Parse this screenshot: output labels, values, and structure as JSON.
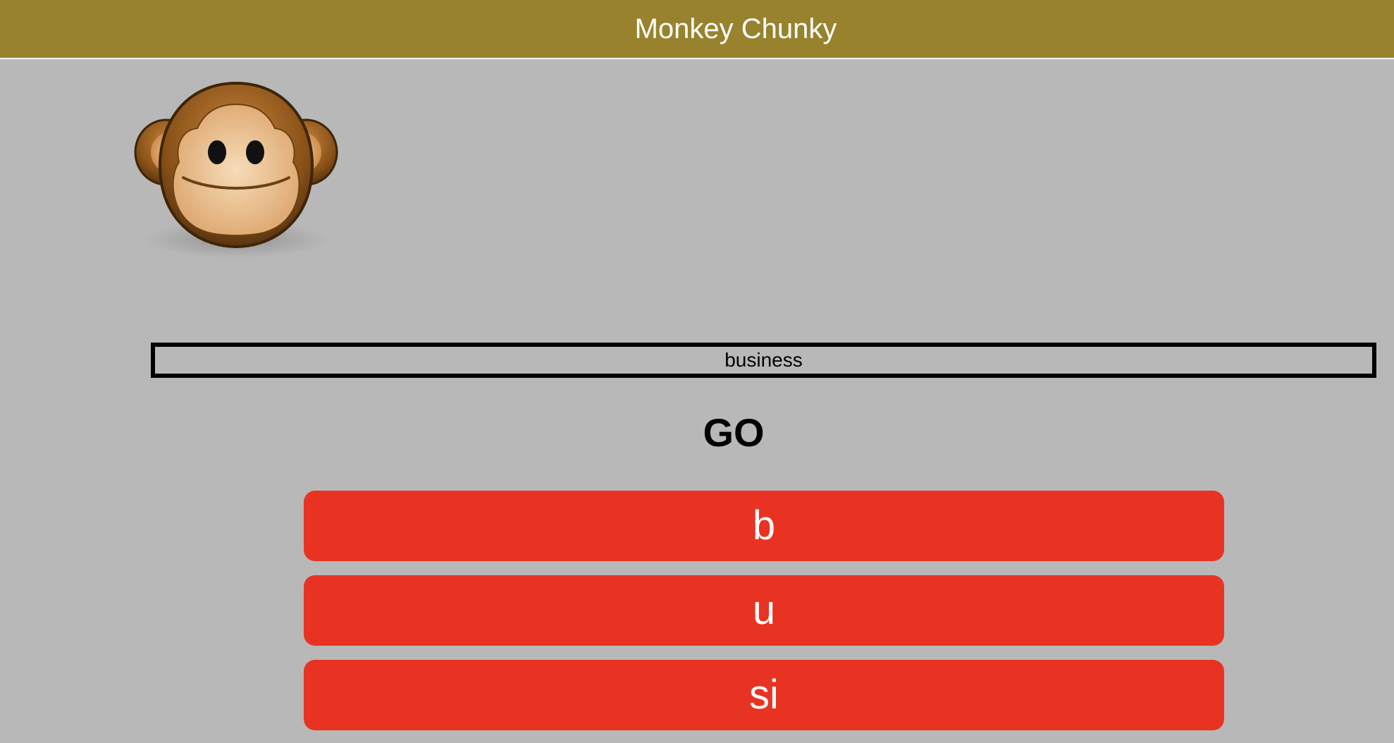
{
  "header": {
    "title": "Monkey Chunky",
    "background": "#98822e"
  },
  "logo": {
    "icon": "monkey-face-icon"
  },
  "word": {
    "text": "business"
  },
  "go": {
    "label": "GO"
  },
  "chunks": [
    {
      "label": "b"
    },
    {
      "label": "u"
    },
    {
      "label": "si"
    }
  ],
  "colors": {
    "page_background": "#b8b8b8",
    "chunk_button": "#e83323",
    "chunk_text": "#ffffff"
  }
}
